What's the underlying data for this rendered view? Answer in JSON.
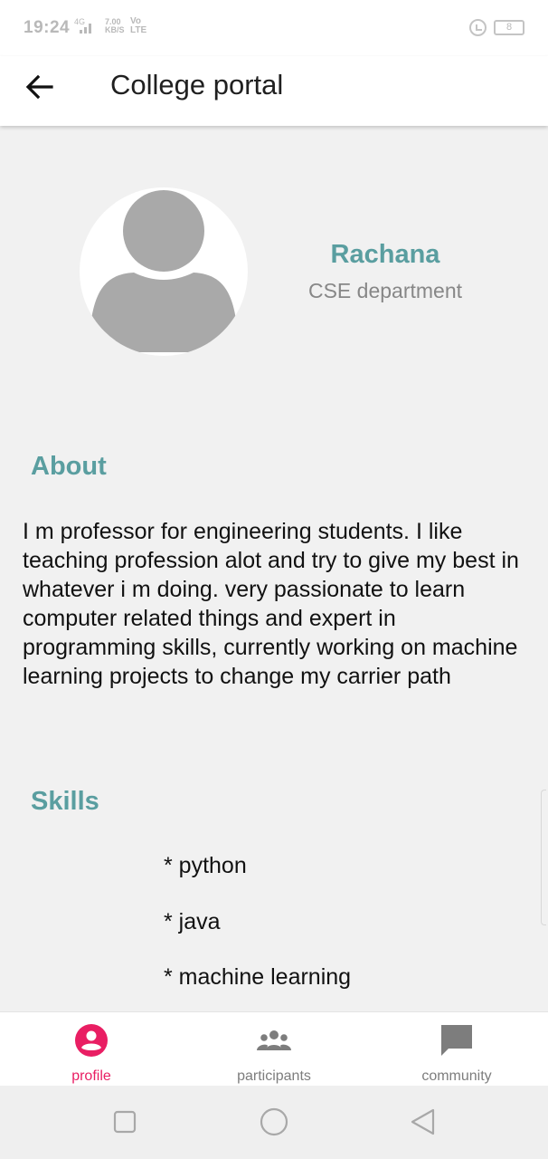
{
  "status_bar": {
    "time": "19:24",
    "signal": "4G",
    "network_speed": "7.00",
    "network_speed_unit": "KB/S",
    "volte": "Vo LTE",
    "battery_level": "8"
  },
  "app_bar": {
    "title": "College portal"
  },
  "profile": {
    "name": "Rachana",
    "department": "CSE department"
  },
  "about": {
    "heading": "About",
    "text": "I m professor for engineering students. I like teaching profession alot and try to give my best in whatever i m doing. very passionate to learn computer related things and expert in programming skills, currently working on machine learning projects to change my carrier path"
  },
  "skills": {
    "heading": "Skills",
    "items": [
      "* python",
      "* java",
      "* machine learning"
    ]
  },
  "bottom_nav": {
    "items": [
      {
        "label": "profile",
        "icon": "account-circle-icon",
        "active": true
      },
      {
        "label": "participants",
        "icon": "group-icon",
        "active": false
      },
      {
        "label": "community",
        "icon": "chat-icon",
        "active": false
      }
    ],
    "active_color": "#e91e63",
    "inactive_color": "#7d7d7d"
  },
  "system_nav": {
    "buttons": [
      "recents-icon",
      "home-icon",
      "back-icon"
    ]
  },
  "colors": {
    "accent": "#5a9ea0",
    "background": "#f1f1f1"
  }
}
